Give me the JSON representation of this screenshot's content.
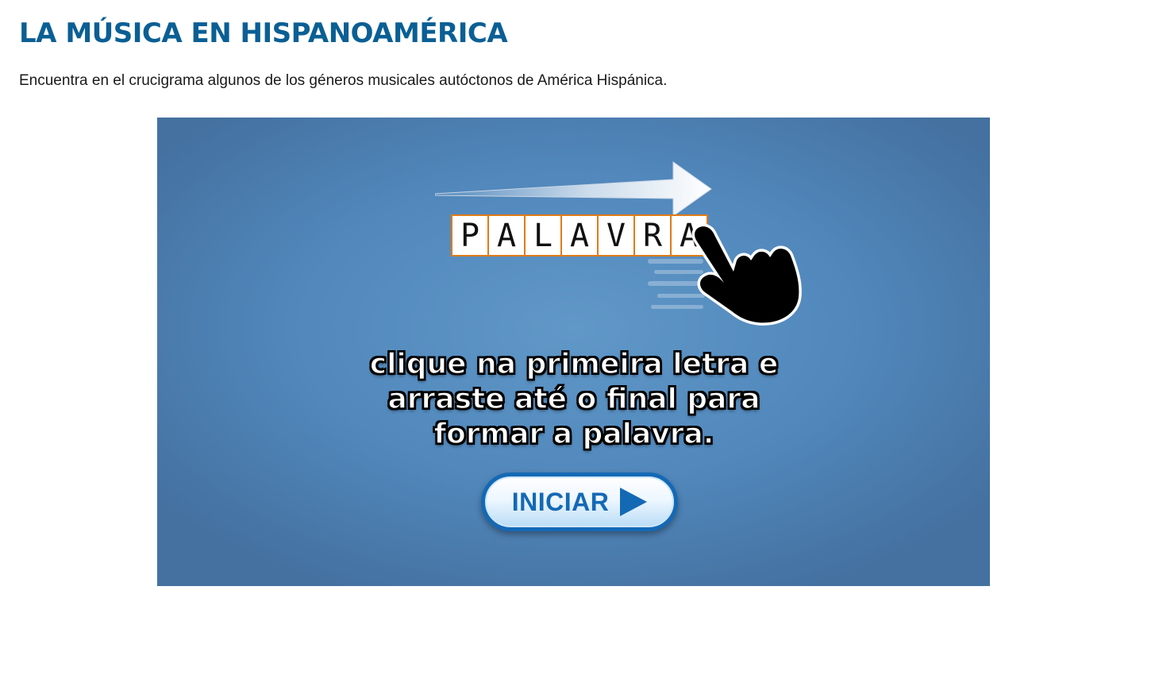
{
  "page": {
    "title": "LA MÚSICA EN HISPANOAMÉRICA",
    "intro": "Encuentra en el crucigrama algunos de los géneros musicales autóctonos de América Hispánica."
  },
  "game": {
    "example_letters": [
      "P",
      "A",
      "L",
      "A",
      "V",
      "R",
      "A"
    ],
    "instruction_lines": [
      "clique na primeira letra e",
      "arraste até o final para",
      "formar a palavra."
    ],
    "start_button_label": "INICIAR",
    "icons": [
      "swipe-arrow-icon",
      "pointing-hand-icon",
      "play-icon"
    ],
    "colors": {
      "title": "#0a5f94",
      "background": "#5187bb",
      "letter_border": "#e07b18",
      "button": "#1469b5"
    }
  }
}
